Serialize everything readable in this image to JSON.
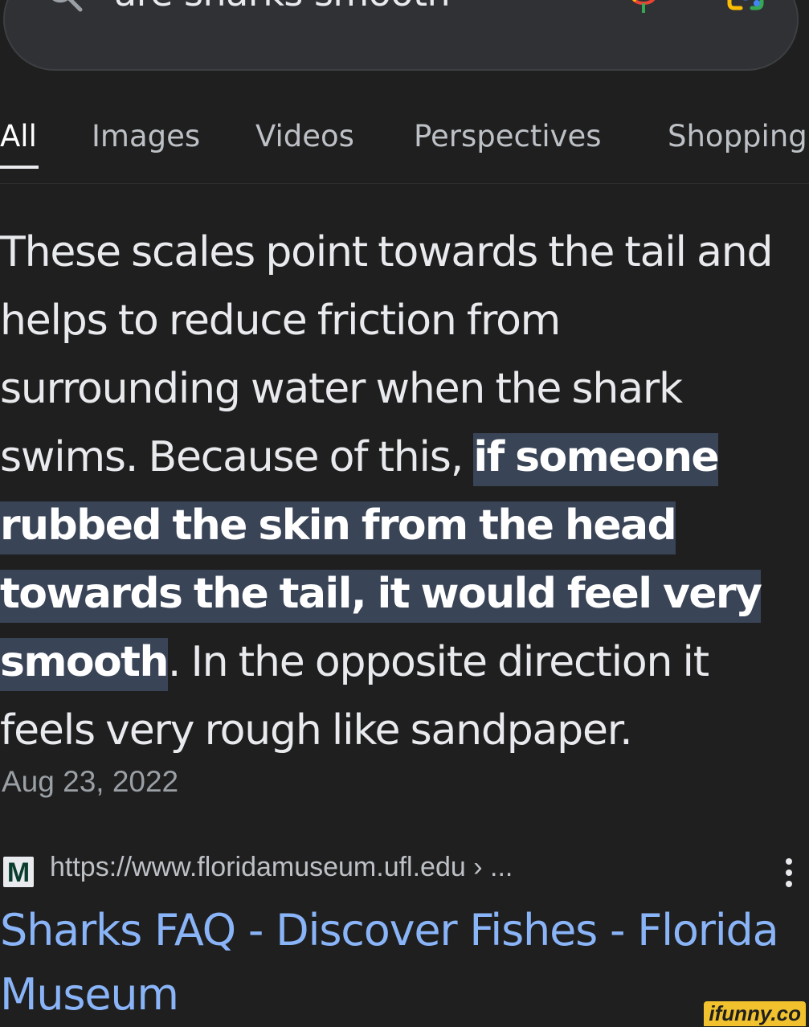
{
  "search": {
    "query": "are sharks smooth"
  },
  "tabs": [
    {
      "label": "All",
      "active": true
    },
    {
      "label": "Images",
      "active": false
    },
    {
      "label": "Videos",
      "active": false
    },
    {
      "label": "Perspectives",
      "active": false
    },
    {
      "label": "Shopping",
      "active": false
    }
  ],
  "snippet": {
    "text_before": "These scales point towards the tail and helps to reduce friction from surrounding water when the shark swims. Because of this, ",
    "highlight": "if someone rubbed the skin from the head towards the tail, it would feel very smooth",
    "text_after": ". In the opposite direction it feels very rough like sandpaper.",
    "date": "Aug 23, 2022"
  },
  "result": {
    "favicon_letter": "M",
    "url": "https://www.floridamuseum.ufl.edu › ...",
    "title": "Sharks FAQ - Discover Fishes - Florida Museum"
  },
  "watermark": "ifunny.co",
  "colors": {
    "background": "#1f1f1f",
    "search_bar": "#303134",
    "highlight": "#394457",
    "link": "#8ab4f8",
    "text": "#e8eaed"
  },
  "icons": [
    "search-icon",
    "mic-icon",
    "lens-icon",
    "more-vert-icon"
  ]
}
